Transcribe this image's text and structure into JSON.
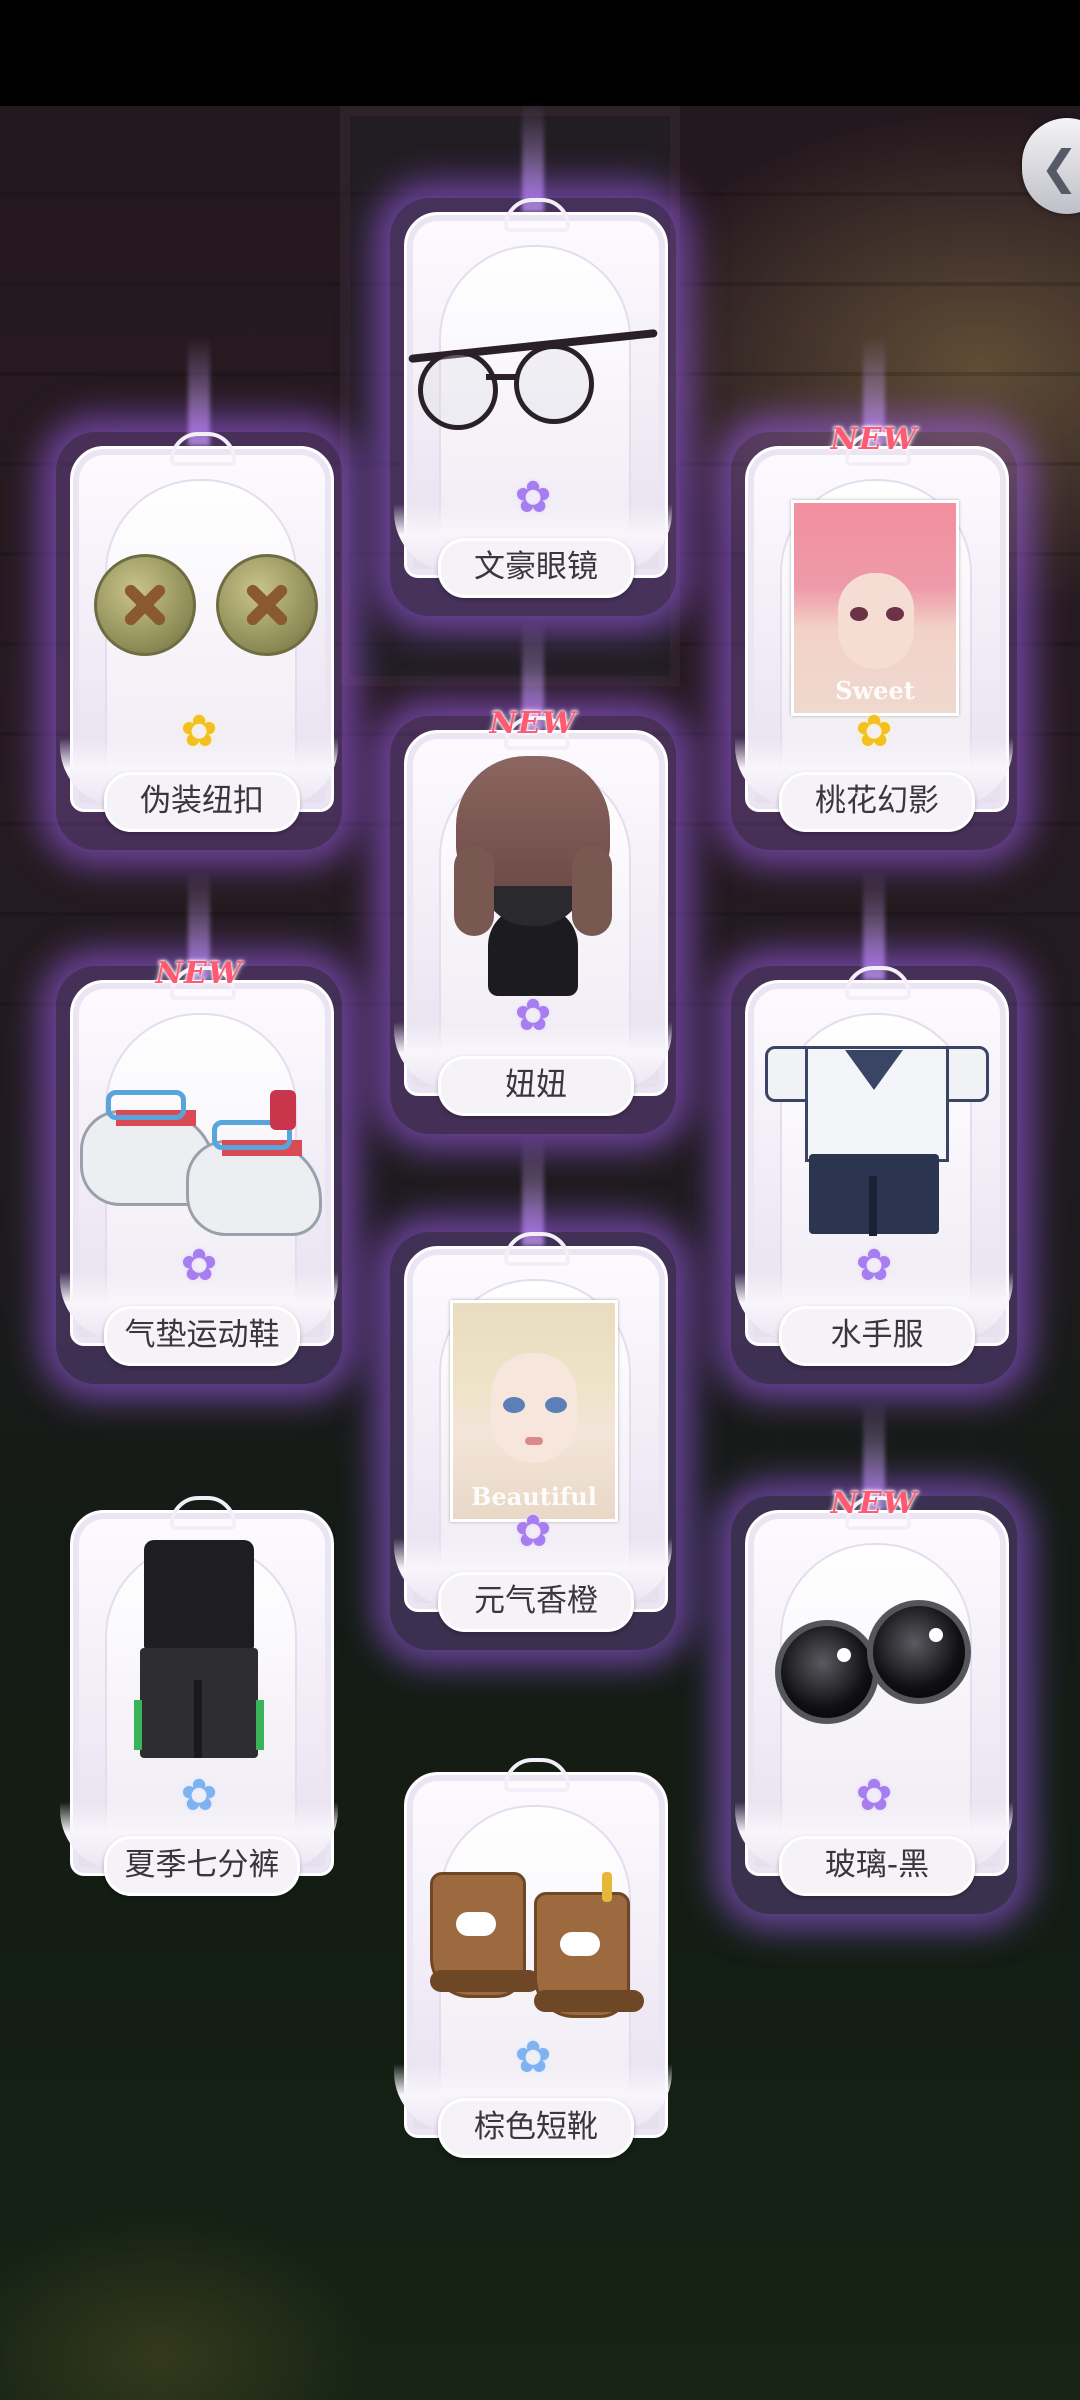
{
  "back_button": {
    "icon": "chevron-left-icon"
  },
  "new_label": "NEW",
  "items": [
    {
      "name": "文豪眼镜",
      "rarity_star": "purple",
      "is_new": false,
      "icon": "round-glasses-icon"
    },
    {
      "name": "伪装纽扣",
      "rarity_star": "gold",
      "is_new": false,
      "icon": "buttons-icon"
    },
    {
      "name": "桃花幻影",
      "rarity_star": "gold",
      "is_new": true,
      "icon": "pink-hair-makeup-portrait",
      "caption": "Sweet"
    },
    {
      "name": "妞妞",
      "rarity_star": "purple",
      "is_new": true,
      "icon": "braided-wig-icon"
    },
    {
      "name": "气垫运动鞋",
      "rarity_star": "purple",
      "is_new": true,
      "icon": "sneakers-icon"
    },
    {
      "name": "水手服",
      "rarity_star": "purple",
      "is_new": false,
      "icon": "sailor-outfit-icon"
    },
    {
      "name": "元气香橙",
      "rarity_star": "purple",
      "is_new": false,
      "icon": "blonde-makeup-portrait",
      "caption": "Beautiful"
    },
    {
      "name": "夏季七分裤",
      "rarity_star": "blue",
      "is_new": false,
      "icon": "summer-cropped-pants-outfit-icon"
    },
    {
      "name": "玻璃-黑",
      "rarity_star": "purple",
      "is_new": true,
      "icon": "black-glass-eyes-icon"
    },
    {
      "name": "棕色短靴",
      "rarity_star": "blue",
      "is_new": false,
      "icon": "brown-boots-icon"
    }
  ]
}
